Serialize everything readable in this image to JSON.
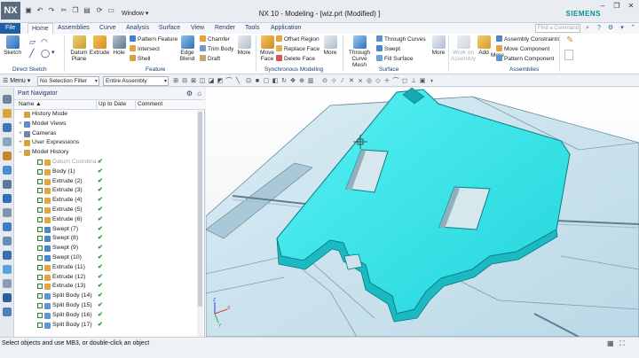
{
  "title_bar": {
    "logo": "NX",
    "window_menu": "Window",
    "title": "NX 10 - Modeling - [wiz.prt (Modified) ]",
    "brand": "SIEMENS",
    "quick_access_icons": [
      "save-icon",
      "undo-icon",
      "redo-icon",
      "cut-icon",
      "copy-icon",
      "paste-icon",
      "repeat-icon",
      "switch-window-icon"
    ]
  },
  "ribbon_tabs": {
    "file": "File",
    "tabs": [
      "Home",
      "Assemblies",
      "Curve",
      "Analysis",
      "Surface",
      "View",
      "Render",
      "Tools",
      "Application"
    ],
    "active": "Home",
    "command_search_placeholder": "Find a Command"
  },
  "ribbon": {
    "direct_sketch": {
      "label": "Direct Sketch",
      "sketch": "Sketch"
    },
    "feature": {
      "label": "Feature",
      "datum_plane": [
        "Datum",
        "Plane"
      ],
      "extrude": "Extrude",
      "hole": "Hole",
      "pattern_feature": "Pattern Feature",
      "intersect": "Intersect",
      "shell": "Shell",
      "edge_blend": [
        "Edge",
        "Blend"
      ],
      "chamfer": "Chamfer",
      "trim_body": "Trim Body",
      "draft": "Draft",
      "more": "More"
    },
    "synchronous": {
      "label": "Synchronous Modeling",
      "move_face": [
        "Move",
        "Face"
      ],
      "offset_region": "Offset Region",
      "replace_face": "Replace Face",
      "delete_face": "Delete Face",
      "more": "More"
    },
    "surface": {
      "label": "Surface",
      "through_curve_mesh": [
        "Through",
        "Curve Mesh"
      ],
      "through_curves": "Through Curves",
      "swept": "Swept",
      "fill_surface": "Fill Surface",
      "more": "More"
    },
    "assemblies": {
      "label": "Assemblies",
      "work_on_assembly": [
        "Work on",
        "Assembly"
      ],
      "add": "Add",
      "more": "More",
      "assembly_constraints": "Assembly Constraints",
      "move_component": "Move Component",
      "pattern_component": "Pattern Component"
    }
  },
  "filter_bar": {
    "menu": "Menu",
    "selection_filter": "No Selection Filter",
    "scope": "Entire Assembly"
  },
  "part_navigator": {
    "title": "Part Navigator",
    "columns": [
      "Name",
      "Up to Date",
      "Comment"
    ],
    "rows": [
      {
        "label": "History Mode",
        "level": 0,
        "expand": "",
        "up_to_date": ""
      },
      {
        "label": "Model Views",
        "level": 0,
        "expand": "+",
        "up_to_date": ""
      },
      {
        "label": "Cameras",
        "level": 0,
        "expand": "+",
        "up_to_date": ""
      },
      {
        "label": "User Expressions",
        "level": 0,
        "expand": "+",
        "up_to_date": ""
      },
      {
        "label": "Model History",
        "level": 0,
        "expand": "−",
        "up_to_date": ""
      },
      {
        "label": "Datum Coordina...",
        "level": 1,
        "expand": "",
        "up_to_date": "✔",
        "dim": true
      },
      {
        "label": "Body (1)",
        "level": 1,
        "expand": "",
        "up_to_date": "✔"
      },
      {
        "label": "Extrude (2)",
        "level": 1,
        "expand": "",
        "up_to_date": "✔"
      },
      {
        "label": "Extrude (3)",
        "level": 1,
        "expand": "",
        "up_to_date": "✔"
      },
      {
        "label": "Extrude (4)",
        "level": 1,
        "expand": "",
        "up_to_date": "✔"
      },
      {
        "label": "Extrude (5)",
        "level": 1,
        "expand": "",
        "up_to_date": "✔"
      },
      {
        "label": "Extrude (6)",
        "level": 1,
        "expand": "",
        "up_to_date": "✔"
      },
      {
        "label": "Swept (7)",
        "level": 1,
        "expand": "",
        "up_to_date": "✔"
      },
      {
        "label": "Swept (8)",
        "level": 1,
        "expand": "",
        "up_to_date": "✔"
      },
      {
        "label": "Swept (9)",
        "level": 1,
        "expand": "",
        "up_to_date": "✔"
      },
      {
        "label": "Swept (10)",
        "level": 1,
        "expand": "",
        "up_to_date": "✔"
      },
      {
        "label": "Extrude (11)",
        "level": 1,
        "expand": "",
        "up_to_date": "✔"
      },
      {
        "label": "Extrude (12)",
        "level": 1,
        "expand": "",
        "up_to_date": "✔"
      },
      {
        "label": "Extrude (13)",
        "level": 1,
        "expand": "",
        "up_to_date": "✔"
      },
      {
        "label": "Split Body (14)",
        "level": 1,
        "expand": "",
        "up_to_date": "✔"
      },
      {
        "label": "Split Body (15)",
        "level": 1,
        "expand": "",
        "up_to_date": "✔"
      },
      {
        "label": "Split Body (16)",
        "level": 1,
        "expand": "",
        "up_to_date": "✔"
      },
      {
        "label": "Split Body (17)",
        "level": 1,
        "expand": "",
        "up_to_date": "✔"
      }
    ]
  },
  "status_bar": {
    "message": "Select objects and use MB3, or double-click an object"
  },
  "colors": {
    "part_cyan": "#2fe6ea",
    "base_plate": "#cfe6f0",
    "accent_blue": "#1f5fa4",
    "check_green": "#1d9a2b"
  }
}
